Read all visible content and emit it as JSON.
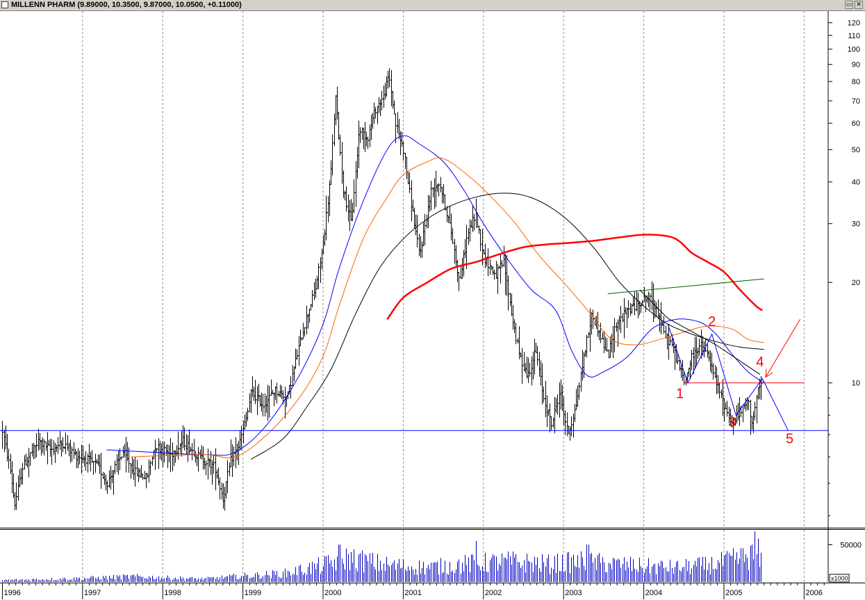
{
  "window": {
    "title": "MILLENN PHARM (9.89000, 10.3500, 9.87000, 10.0500, +0.11000)",
    "restore_glyph": "▭",
    "close_glyph": "✕"
  },
  "chart_data": [
    {
      "type": "bar",
      "subtype": "ohlc-weekly",
      "y_scale": "log",
      "ylim": [
        3.7,
        130
      ],
      "xlim": [
        "1996-01",
        "2006-03"
      ],
      "grid": true,
      "y_ticks": [
        10,
        20,
        30,
        40,
        50,
        60,
        70,
        80,
        90,
        100,
        110,
        120
      ],
      "x_tick_labels": [
        "1996",
        "1997",
        "1998",
        "1999",
        "2000",
        "2001",
        "2002",
        "2003",
        "2004",
        "2005",
        "2006"
      ],
      "price_path": [
        [
          1996.0,
          7.2
        ],
        [
          1996.1,
          5.4
        ],
        [
          1996.15,
          4.3
        ],
        [
          1996.25,
          5.6
        ],
        [
          1996.45,
          6.7
        ],
        [
          1996.6,
          6.3
        ],
        [
          1996.75,
          6.6
        ],
        [
          1996.9,
          6.1
        ],
        [
          1997.05,
          5.9
        ],
        [
          1997.2,
          5.6
        ],
        [
          1997.3,
          5.0
        ],
        [
          1997.5,
          6.2
        ],
        [
          1997.65,
          5.4
        ],
        [
          1997.8,
          5.2
        ],
        [
          1997.9,
          6.5
        ],
        [
          1998.1,
          6.1
        ],
        [
          1998.25,
          6.7
        ],
        [
          1998.45,
          6.0
        ],
        [
          1998.65,
          5.6
        ],
        [
          1998.75,
          4.5
        ],
        [
          1998.85,
          5.9
        ],
        [
          1998.95,
          6.5
        ],
        [
          1999.05,
          8.0
        ],
        [
          1999.1,
          9.4
        ],
        [
          1999.25,
          8.6
        ],
        [
          1999.4,
          9.5
        ],
        [
          1999.55,
          9.0
        ],
        [
          1999.7,
          13.0
        ],
        [
          1999.8,
          16.0
        ],
        [
          1999.9,
          19.0
        ],
        [
          2000.0,
          26.0
        ],
        [
          2000.1,
          44.0
        ],
        [
          2000.15,
          73.0
        ],
        [
          2000.25,
          38.0
        ],
        [
          2000.35,
          30.0
        ],
        [
          2000.45,
          58.0
        ],
        [
          2000.55,
          54.0
        ],
        [
          2000.65,
          66.0
        ],
        [
          2000.75,
          72.0
        ],
        [
          2000.82,
          83.0
        ],
        [
          2000.9,
          60.0
        ],
        [
          2001.0,
          50.0
        ],
        [
          2001.1,
          34.0
        ],
        [
          2001.2,
          24.0
        ],
        [
          2001.35,
          38.0
        ],
        [
          2001.45,
          40.0
        ],
        [
          2001.6,
          28.0
        ],
        [
          2001.7,
          20.0
        ],
        [
          2001.8,
          28.0
        ],
        [
          2001.9,
          32.0
        ],
        [
          2002.0,
          24.0
        ],
        [
          2002.15,
          21.0
        ],
        [
          2002.25,
          23.0
        ],
        [
          2002.35,
          16.0
        ],
        [
          2002.45,
          12.0
        ],
        [
          2002.55,
          10.5
        ],
        [
          2002.65,
          12.5
        ],
        [
          2002.75,
          9.0
        ],
        [
          2002.85,
          7.5
        ],
        [
          2002.95,
          9.5
        ],
        [
          2003.05,
          7.0
        ],
        [
          2003.15,
          8.5
        ],
        [
          2003.25,
          12.0
        ],
        [
          2003.35,
          16.0
        ],
        [
          2003.45,
          14.0
        ],
        [
          2003.55,
          12.0
        ],
        [
          2003.65,
          15.0
        ],
        [
          2003.8,
          16.5
        ],
        [
          2003.95,
          17.5
        ],
        [
          2004.05,
          18.0
        ],
        [
          2004.15,
          17.0
        ],
        [
          2004.25,
          14.0
        ],
        [
          2004.35,
          13.0
        ],
        [
          2004.45,
          11.0
        ],
        [
          2004.5,
          10.0
        ],
        [
          2004.6,
          12.0
        ],
        [
          2004.7,
          13.0
        ],
        [
          2004.8,
          12.0
        ],
        [
          2004.9,
          10.0
        ],
        [
          2005.0,
          8.6
        ],
        [
          2005.1,
          7.6
        ],
        [
          2005.2,
          8.2
        ],
        [
          2005.3,
          8.8
        ],
        [
          2005.35,
          7.6
        ],
        [
          2005.42,
          9.4
        ],
        [
          2005.48,
          10.05
        ]
      ],
      "moving_averages": [
        {
          "color": "#0000ff",
          "points": [
            [
              1997.3,
              6.3
            ],
            [
              1998.5,
              6.1
            ],
            [
              1998.9,
              6.2
            ],
            [
              1999.3,
              7.5
            ],
            [
              1999.7,
              10.5
            ],
            [
              2000.0,
              15.0
            ],
            [
              2000.2,
              22.0
            ],
            [
              2000.5,
              35.0
            ],
            [
              2000.8,
              50.0
            ],
            [
              2001.0,
              55.0
            ],
            [
              2001.2,
              52.0
            ],
            [
              2001.5,
              46.0
            ],
            [
              2001.75,
              38.0
            ],
            [
              2002.0,
              30.0
            ],
            [
              2002.3,
              23.5
            ],
            [
              2002.6,
              19.0
            ],
            [
              2002.9,
              16.5
            ],
            [
              2003.1,
              12.5
            ],
            [
              2003.3,
              10.5
            ],
            [
              2003.5,
              10.8
            ],
            [
              2003.8,
              12.0
            ],
            [
              2004.1,
              14.5
            ],
            [
              2004.4,
              15.5
            ],
            [
              2004.7,
              15.2
            ],
            [
              2004.9,
              14.0
            ],
            [
              2005.1,
              12.2
            ],
            [
              2005.3,
              10.8
            ],
            [
              2005.5,
              10.0
            ]
          ]
        },
        {
          "color": "#ff6000",
          "points": [
            [
              1997.6,
              6.0
            ],
            [
              1998.5,
              6.1
            ],
            [
              1998.9,
              6.0
            ],
            [
              1999.3,
              7.0
            ],
            [
              1999.7,
              9.0
            ],
            [
              2000.0,
              12.0
            ],
            [
              2000.2,
              17.0
            ],
            [
              2000.5,
              27.0
            ],
            [
              2000.8,
              36.0
            ],
            [
              2001.0,
              42.0
            ],
            [
              2001.3,
              46.0
            ],
            [
              2001.5,
              47.0
            ],
            [
              2001.8,
              42.0
            ],
            [
              2002.1,
              36.0
            ],
            [
              2002.4,
              30.0
            ],
            [
              2002.7,
              24.0
            ],
            [
              2003.0,
              20.0
            ],
            [
              2003.3,
              16.5
            ],
            [
              2003.6,
              13.5
            ],
            [
              2003.9,
              13.0
            ],
            [
              2004.2,
              13.5
            ],
            [
              2004.5,
              14.2
            ],
            [
              2004.8,
              14.8
            ],
            [
              2005.1,
              14.5
            ],
            [
              2005.3,
              13.5
            ],
            [
              2005.5,
              13.2
            ]
          ]
        },
        {
          "color": "#000000",
          "points": [
            [
              1999.1,
              5.9
            ],
            [
              1999.5,
              6.8
            ],
            [
              1999.8,
              8.5
            ],
            [
              2000.1,
              11.0
            ],
            [
              2000.4,
              16.0
            ],
            [
              2000.7,
              22.0
            ],
            [
              2001.0,
              27.0
            ],
            [
              2001.3,
              31.0
            ],
            [
              2001.6,
              34.0
            ],
            [
              2001.9,
              36.0
            ],
            [
              2002.2,
              37.0
            ],
            [
              2002.5,
              36.5
            ],
            [
              2002.8,
              34.0
            ],
            [
              2003.1,
              30.0
            ],
            [
              2003.4,
              25.0
            ],
            [
              2003.7,
              20.0
            ],
            [
              2004.0,
              17.0
            ],
            [
              2004.3,
              15.0
            ],
            [
              2004.6,
              14.0
            ],
            [
              2004.9,
              13.3
            ],
            [
              2005.2,
              12.8
            ],
            [
              2005.5,
              12.6
            ]
          ]
        },
        {
          "color": "#ff0000",
          "points": [
            [
              2000.8,
              15.5
            ],
            [
              2001.0,
              18.0
            ],
            [
              2001.3,
              20.0
            ],
            [
              2001.6,
              22.0
            ],
            [
              2001.9,
              23.0
            ],
            [
              2002.2,
              24.3
            ],
            [
              2002.5,
              25.5
            ],
            [
              2002.8,
              26.0
            ],
            [
              2003.1,
              26.3
            ],
            [
              2003.4,
              26.7
            ],
            [
              2003.7,
              27.3
            ],
            [
              2004.0,
              27.8
            ],
            [
              2004.3,
              27.5
            ],
            [
              2004.45,
              26.5
            ],
            [
              2004.6,
              24.5
            ],
            [
              2004.8,
              23.0
            ],
            [
              2005.0,
              21.5
            ],
            [
              2005.2,
              19.0
            ],
            [
              2005.4,
              17.0
            ],
            [
              2005.48,
              16.5
            ]
          ]
        }
      ],
      "drawn_lines": [
        {
          "color": "#0000ff",
          "points": [
            [
              1995.95,
              7.2
            ],
            [
              2006.3,
              7.2
            ]
          ]
        },
        {
          "color": "#ff0000",
          "points": [
            [
              2004.5,
              10.0
            ],
            [
              2006.0,
              10.0
            ]
          ]
        },
        {
          "color": "#006000",
          "points": [
            [
              2003.55,
              18.5
            ],
            [
              2005.5,
              20.5
            ]
          ]
        },
        {
          "color": "#0000ff",
          "points": [
            [
              2004.3,
              15.0
            ],
            [
              2004.55,
              10.0
            ],
            [
              2004.85,
              14.0
            ],
            [
              2005.15,
              8.0
            ],
            [
              2005.48,
              10.3
            ],
            [
              2005.8,
              7.2
            ]
          ]
        },
        {
          "color": "#000000",
          "points": [
            [
              2003.95,
              19.0
            ],
            [
              2004.3,
              15.6
            ],
            [
              2004.9,
              13.0
            ],
            [
              2005.45,
              10.6
            ]
          ]
        }
      ],
      "arrow": {
        "color": "#ff0000",
        "points": [
          [
            2005.95,
            15.5
          ],
          [
            2005.52,
            10.4
          ]
        ]
      },
      "annotations": [
        {
          "text": "1",
          "x": 2004.45,
          "y": 9.0
        },
        {
          "text": "2",
          "x": 2004.85,
          "y": 14.8
        },
        {
          "text": "3",
          "x": 2005.1,
          "y": 7.4
        },
        {
          "text": "4",
          "x": 2005.45,
          "y": 11.2
        },
        {
          "text": "5",
          "x": 2005.82,
          "y": 6.6
        }
      ]
    },
    {
      "type": "bar",
      "subtype": "volume",
      "y_ticks": [
        50000
      ],
      "unit_label": "x1000",
      "ylim": [
        0,
        70000
      ],
      "volume_profile": [
        [
          1996.0,
          3000
        ],
        [
          1997.0,
          6000
        ],
        [
          1997.6,
          9000
        ],
        [
          1998.5,
          5000
        ],
        [
          1998.9,
          9000
        ],
        [
          1999.5,
          14000
        ],
        [
          2000.0,
          28000
        ],
        [
          2000.3,
          40000
        ],
        [
          2000.8,
          28000
        ],
        [
          2001.3,
          24000
        ],
        [
          2001.8,
          30000
        ],
        [
          2002.3,
          34000
        ],
        [
          2002.8,
          30000
        ],
        [
          2003.2,
          34000
        ],
        [
          2003.6,
          30000
        ],
        [
          2004.0,
          26000
        ],
        [
          2004.4,
          24000
        ],
        [
          2004.8,
          28000
        ],
        [
          2005.1,
          36000
        ],
        [
          2005.35,
          44000
        ],
        [
          2005.48,
          30000
        ]
      ],
      "spikes": [
        [
          2000.2,
          50000
        ],
        [
          2001.9,
          55000
        ],
        [
          2003.3,
          50000
        ],
        [
          2005.38,
          68000
        ],
        [
          2005.42,
          58000
        ]
      ]
    }
  ]
}
